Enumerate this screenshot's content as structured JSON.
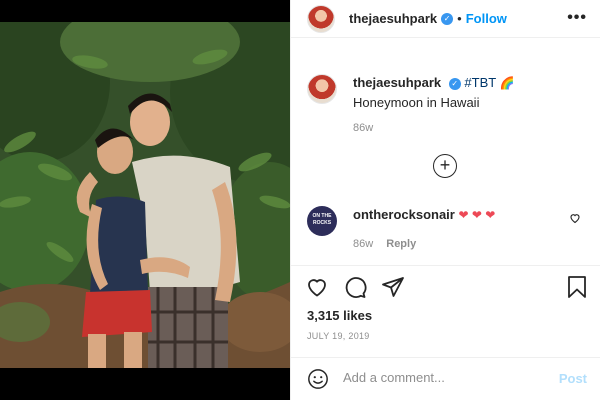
{
  "post": {
    "username": "thejaesuhpark",
    "follow_label": "Follow",
    "dot": "•",
    "more_label": "•••"
  },
  "caption": {
    "username": "thejaesuhpark",
    "hashtag": "#TBT",
    "emoji": "🌈",
    "text": "Honeymoon in Hawaii",
    "time": "86w"
  },
  "load_more_label": "+",
  "comment": {
    "avatar_text": "ON THE ROCKS",
    "username": "ontherocksonair",
    "hearts": "❤ ❤ ❤",
    "time": "86w",
    "reply_label": "Reply"
  },
  "likes": "3,315 likes",
  "date": "JULY 19, 2019",
  "comment_bar": {
    "placeholder": "Add a comment...",
    "post_label": "Post"
  }
}
